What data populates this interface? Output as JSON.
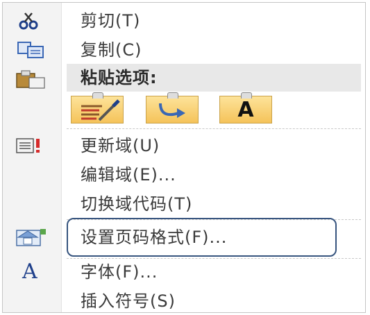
{
  "menu": {
    "items": [
      {
        "label": "剪切(T)",
        "icon": "scissors-icon"
      },
      {
        "label": "复制(C)",
        "icon": "copy-icon"
      },
      {
        "label": "更新域(U)",
        "icon": "update-field-icon"
      },
      {
        "label": "编辑域(E)...",
        "icon": ""
      },
      {
        "label": "切换域代码(T)",
        "icon": ""
      },
      {
        "label": "设置页码格式(F)...",
        "icon": "page-number-format-icon"
      },
      {
        "label": "字体(F)...",
        "icon": "font-icon"
      },
      {
        "label": "插入符号(S)",
        "icon": ""
      }
    ],
    "paste_header": "粘贴选项:",
    "paste_buttons": [
      "keep-source-formatting",
      "merge-formatting",
      "keep-text-only"
    ],
    "paste_text_only_glyph": "A",
    "font_icon_glyph": "A"
  },
  "colors": {
    "highlight_border": "#36547e",
    "paste_button_fill": "#f5c35a"
  }
}
